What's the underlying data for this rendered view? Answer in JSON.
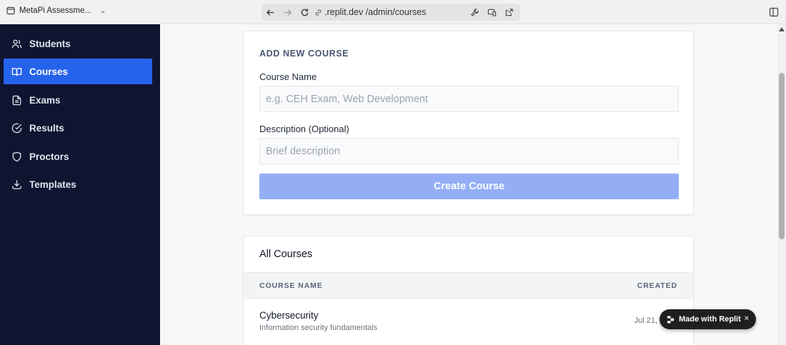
{
  "browser": {
    "tab_title": "MetaPi Assessme...",
    "url": ".replit.dev /admin/courses"
  },
  "sidebar": {
    "items": [
      {
        "label": "Students",
        "icon": "users-icon"
      },
      {
        "label": "Courses",
        "icon": "book-open-icon",
        "active": true
      },
      {
        "label": "Exams",
        "icon": "file-text-icon"
      },
      {
        "label": "Results",
        "icon": "check-circle-icon"
      },
      {
        "label": "Proctors",
        "icon": "shield-icon"
      },
      {
        "label": "Templates",
        "icon": "download-icon"
      }
    ],
    "bg_color": "#0f1530",
    "active_color": "#2563eb"
  },
  "form": {
    "section_title": "ADD NEW COURSE",
    "course_name_label": "Course Name",
    "course_name_placeholder": "e.g. CEH Exam, Web Development",
    "description_label": "Description (Optional)",
    "description_placeholder": "Brief description",
    "create_button": "Create Course"
  },
  "courses": {
    "title": "All Courses",
    "columns": [
      "COURSE NAME",
      "CREATED"
    ],
    "rows": [
      {
        "name": "Cybersecurity",
        "description": "Information security fundamentals",
        "created": "Jul 21,"
      }
    ]
  },
  "badge": {
    "label": "Made with Replit",
    "close": "×"
  }
}
